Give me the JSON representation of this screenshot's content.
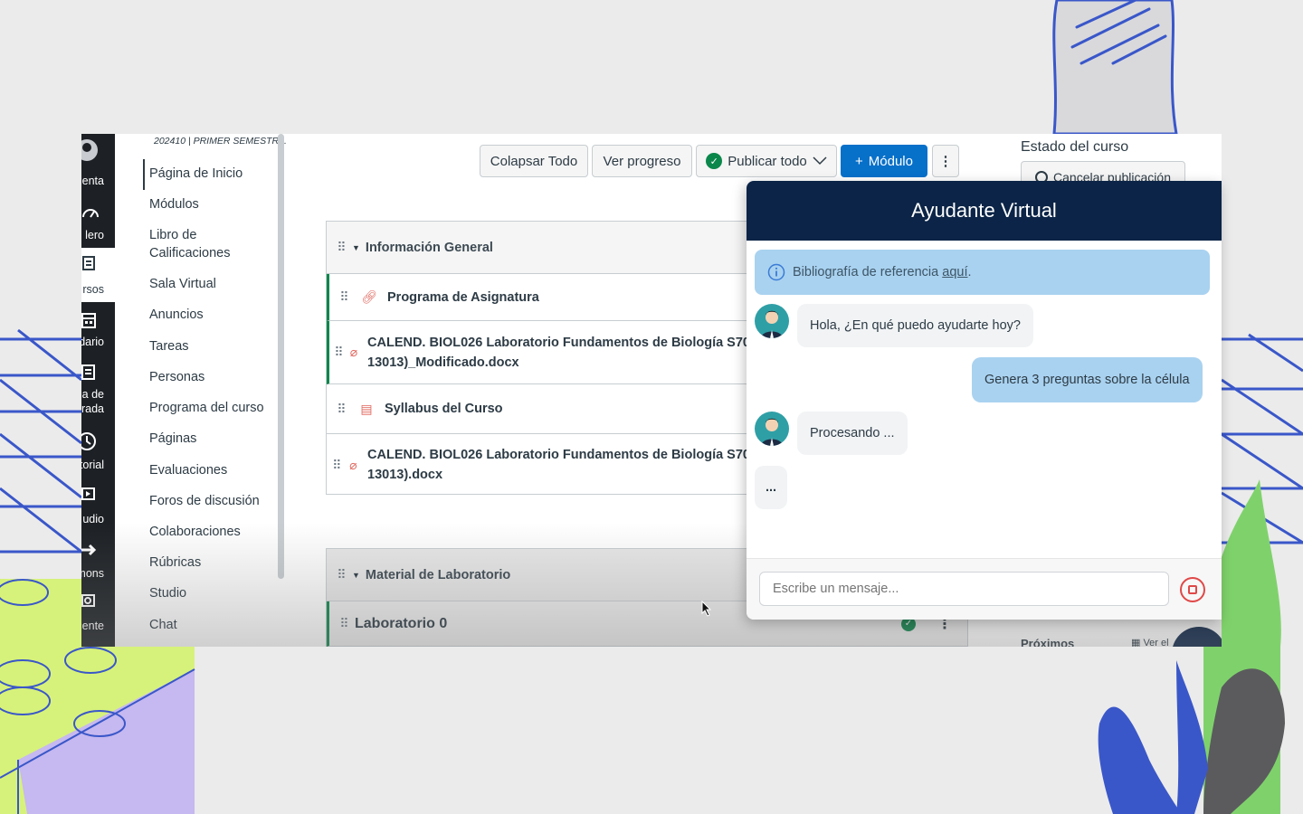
{
  "global_nav": {
    "items": [
      {
        "label": "enta",
        "icon": "account-icon"
      },
      {
        "label": "lero",
        "icon": "dashboard-icon"
      },
      {
        "label": "rsos",
        "icon": "courses-icon"
      },
      {
        "label": "ndario",
        "icon": "calendar-icon"
      },
      {
        "label": "eja de\nrada",
        "icon": "inbox-icon"
      },
      {
        "label": "torial",
        "icon": "history-icon"
      },
      {
        "label": "udio",
        "icon": "studio-icon"
      },
      {
        "label": "mons",
        "icon": "commons-icon"
      },
      {
        "label": "ocente",
        "icon": "teacher-icon"
      }
    ]
  },
  "course_nav": {
    "term": "202410 | PRIMER SEMESTR...",
    "items": [
      "Página de Inicio",
      "Módulos",
      "Libro de Calificaciones",
      "Sala Virtual",
      "Anuncios",
      "Tareas",
      "Personas",
      "Programa del curso",
      "Páginas",
      "Evaluaciones",
      "Foros de discusión",
      "Colaboraciones",
      "Rúbricas",
      "Studio",
      "Chat"
    ]
  },
  "toolbar": {
    "collapse_all": "Colapsar Todo",
    "view_progress": "Ver progreso",
    "publish_all": "Publicar todo",
    "add_module": "Módulo",
    "add_symbol": "+",
    "more": "⋮"
  },
  "modules": [
    {
      "title": "Información General",
      "items": [
        {
          "title": "Programa de Asignatura",
          "icon": "link-icon"
        },
        {
          "title": "CALEND. BIOL026 Laboratorio Fundamentos de Biología S70",
          "title2": "13013)_Modificado.docx",
          "icon": "attachment-icon"
        },
        {
          "title": "Syllabus del Curso",
          "icon": "document-icon"
        },
        {
          "title": "CALEND. BIOL026 Laboratorio Fundamentos de Biología S70",
          "title2": "13013).docx",
          "icon": "attachment-icon"
        }
      ]
    },
    {
      "title": "Material de Laboratorio",
      "items": [
        {
          "title": "Laboratorio 0",
          "icon": "none"
        }
      ]
    }
  ],
  "sidebar": {
    "course_status": "Estado del curso",
    "unpublish": "Cancelar publicación",
    "upcoming": "Próximos",
    "view": "Ver el"
  },
  "chat": {
    "title": "Ayudante Virtual",
    "info_text": "Bibliografía de referencia ",
    "info_link": "aquí",
    "info_tail": ".",
    "messages": [
      {
        "role": "bot",
        "text": "Hola, ¿En qué puedo ayudarte hoy?"
      },
      {
        "role": "user",
        "text": "Genera 3 preguntas sobre la célula"
      },
      {
        "role": "bot",
        "text": "Procesando ..."
      },
      {
        "role": "typing",
        "text": "..."
      }
    ],
    "input_placeholder": "Escribe un mensaje..."
  },
  "colors": {
    "chat_header": "#0b2447",
    "primary_button": "#0770c9",
    "published_green": "#0b874b",
    "info_blue": "#a9d2f0",
    "stop_red": "#e04848"
  }
}
